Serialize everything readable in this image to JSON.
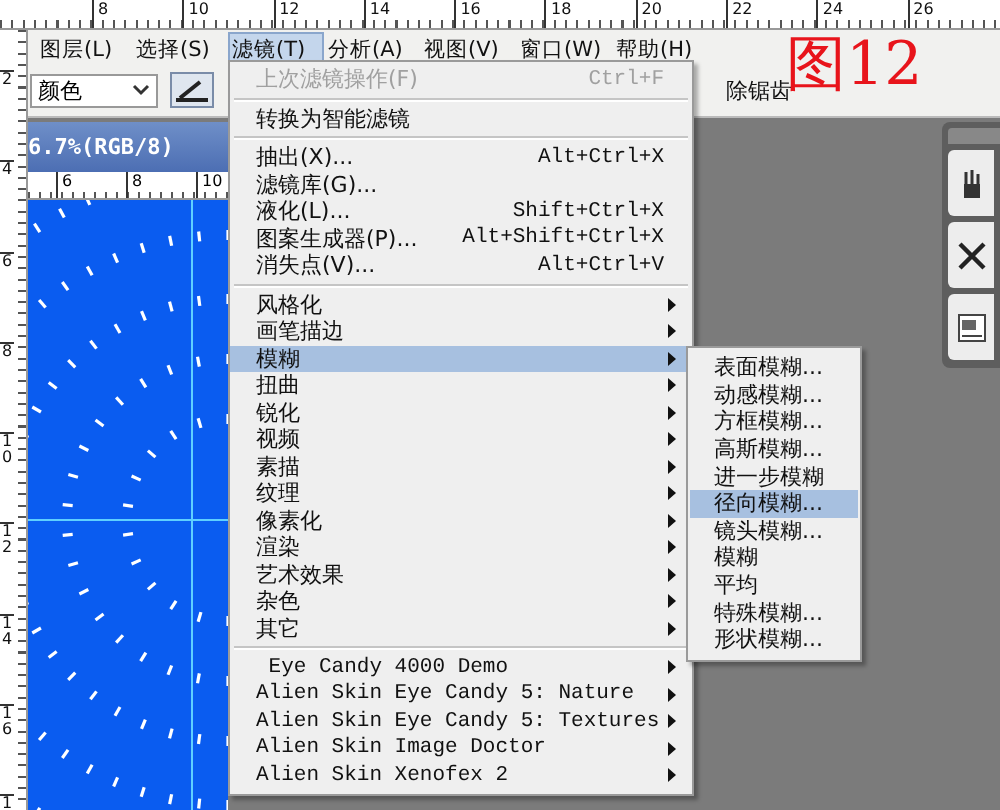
{
  "top_ruler": [
    "8",
    "10",
    "12",
    "14",
    "16",
    "18",
    "20",
    "22",
    "24",
    "26"
  ],
  "left_ruler": [
    "2",
    "4",
    "6",
    "8",
    "10",
    "12",
    "14",
    "16",
    "1"
  ],
  "menu_bar": [
    {
      "label": "图层(L)",
      "selected": false
    },
    {
      "label": "选择(S)",
      "selected": false
    },
    {
      "label": "滤镜(T)",
      "selected": true
    },
    {
      "label": "分析(A)",
      "selected": false
    },
    {
      "label": "视图(V)",
      "selected": false
    },
    {
      "label": "窗口(W)",
      "selected": false
    },
    {
      "label": "帮助(H)",
      "selected": false
    }
  ],
  "options_bar": {
    "mode_dropdown": "颜色",
    "antialias_label": "除锯齿"
  },
  "annotation": "图12",
  "document": {
    "title": "6.7%(RGB/8)",
    "ruler": [
      "6",
      "8",
      "10"
    ]
  },
  "filter_menu": [
    {
      "kind": "item",
      "label": "上次滤镜操作(F)",
      "shortcut": "Ctrl+F",
      "disabled": true,
      "selected": false,
      "submenu": false
    },
    {
      "kind": "separator"
    },
    {
      "kind": "item",
      "label": "转换为智能滤镜",
      "disabled": false,
      "selected": false,
      "submenu": false
    },
    {
      "kind": "separator"
    },
    {
      "kind": "item",
      "label": "抽出(X)...",
      "shortcut": "Alt+Ctrl+X",
      "disabled": false,
      "selected": false,
      "submenu": false
    },
    {
      "kind": "item",
      "label": "滤镜库(G)...",
      "disabled": false,
      "selected": false,
      "submenu": false
    },
    {
      "kind": "item",
      "label": "液化(L)...",
      "shortcut": "Shift+Ctrl+X",
      "disabled": false,
      "selected": false,
      "submenu": false
    },
    {
      "kind": "item",
      "label": "图案生成器(P)...",
      "shortcut": "Alt+Shift+Ctrl+X",
      "disabled": false,
      "selected": false,
      "submenu": false
    },
    {
      "kind": "item",
      "label": "消失点(V)...",
      "shortcut": "Alt+Ctrl+V",
      "disabled": false,
      "selected": false,
      "submenu": false
    },
    {
      "kind": "separator"
    },
    {
      "kind": "item",
      "label": "风格化",
      "disabled": false,
      "selected": false,
      "submenu": true
    },
    {
      "kind": "item",
      "label": "画笔描边",
      "disabled": false,
      "selected": false,
      "submenu": true
    },
    {
      "kind": "item",
      "label": "模糊",
      "disabled": false,
      "selected": true,
      "submenu": true
    },
    {
      "kind": "item",
      "label": "扭曲",
      "disabled": false,
      "selected": false,
      "submenu": true
    },
    {
      "kind": "item",
      "label": "锐化",
      "disabled": false,
      "selected": false,
      "submenu": true
    },
    {
      "kind": "item",
      "label": "视频",
      "disabled": false,
      "selected": false,
      "submenu": true
    },
    {
      "kind": "item",
      "label": "素描",
      "disabled": false,
      "selected": false,
      "submenu": true
    },
    {
      "kind": "item",
      "label": "纹理",
      "disabled": false,
      "selected": false,
      "submenu": true
    },
    {
      "kind": "item",
      "label": "像素化",
      "disabled": false,
      "selected": false,
      "submenu": true
    },
    {
      "kind": "item",
      "label": "渲染",
      "disabled": false,
      "selected": false,
      "submenu": true
    },
    {
      "kind": "item",
      "label": "艺术效果",
      "disabled": false,
      "selected": false,
      "submenu": true
    },
    {
      "kind": "item",
      "label": "杂色",
      "disabled": false,
      "selected": false,
      "submenu": true
    },
    {
      "kind": "item",
      "label": "其它",
      "disabled": false,
      "selected": false,
      "submenu": true
    },
    {
      "kind": "separator"
    },
    {
      "kind": "plugin",
      "label": " Eye Candy 4000 Demo",
      "disabled": false,
      "selected": false,
      "submenu": true
    },
    {
      "kind": "plugin",
      "label": "Alien Skin Eye Candy 5: Nature",
      "disabled": false,
      "selected": false,
      "submenu": true
    },
    {
      "kind": "plugin",
      "label": "Alien Skin Eye Candy 5: Textures",
      "disabled": false,
      "selected": false,
      "submenu": true
    },
    {
      "kind": "plugin",
      "label": "Alien Skin Image Doctor",
      "disabled": false,
      "selected": false,
      "submenu": true
    },
    {
      "kind": "plugin",
      "label": "Alien Skin Xenofex 2",
      "disabled": false,
      "selected": false,
      "submenu": true
    }
  ],
  "blur_submenu": [
    {
      "label": "表面模糊...",
      "selected": false
    },
    {
      "label": "动感模糊...",
      "selected": false
    },
    {
      "label": "方框模糊...",
      "selected": false
    },
    {
      "label": "高斯模糊...",
      "selected": false
    },
    {
      "label": "进一步模糊",
      "selected": false
    },
    {
      "label": "径向模糊...",
      "selected": true
    },
    {
      "label": "镜头模糊...",
      "selected": false
    },
    {
      "label": "模糊",
      "selected": false
    },
    {
      "label": "平均",
      "selected": false
    },
    {
      "label": "特殊模糊...",
      "selected": false
    },
    {
      "label": "形状模糊...",
      "selected": false
    }
  ]
}
